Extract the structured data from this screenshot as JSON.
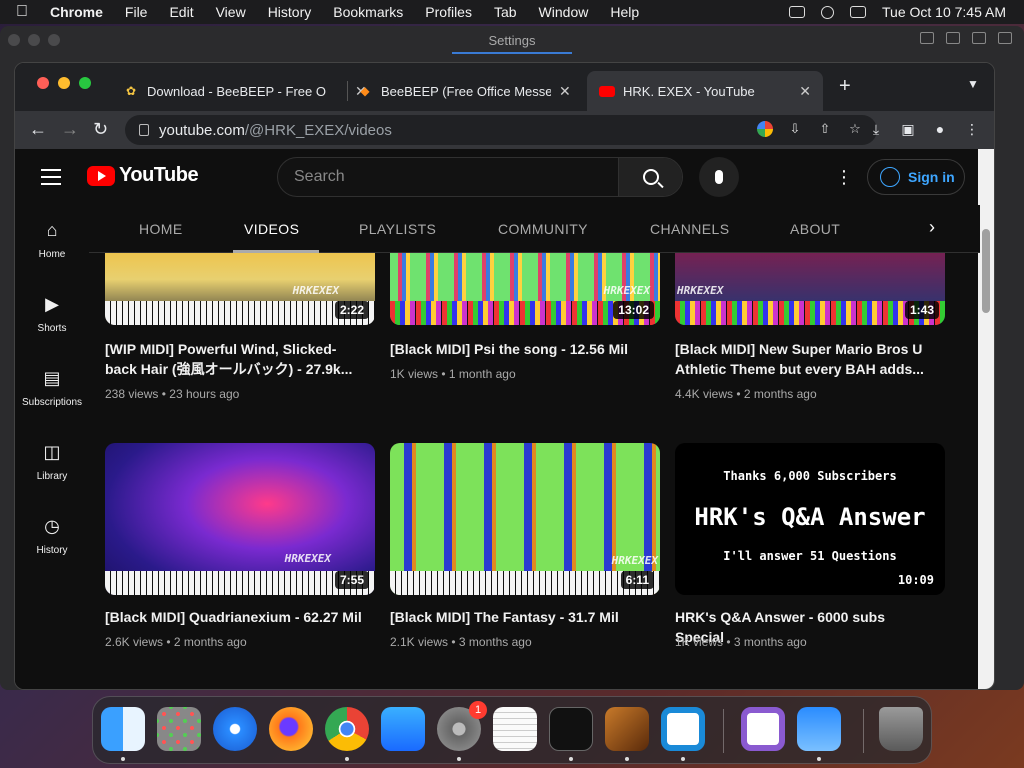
{
  "menubar": {
    "app": "Chrome",
    "items": [
      "File",
      "Edit",
      "View",
      "History",
      "Bookmarks",
      "Profiles",
      "Tab",
      "Window",
      "Help"
    ],
    "clock": "Tue Oct 10  7:45 AM"
  },
  "background_window": {
    "title": "Settings"
  },
  "browser": {
    "tabs": [
      {
        "title": "Download - BeeBEEP - Free O",
        "favicon": "bee-icon"
      },
      {
        "title": "BeeBEEP (Free Office Messen",
        "favicon": "beebeep-icon"
      },
      {
        "title": "HRK. EXEX - YouTube",
        "favicon": "youtube-icon"
      }
    ],
    "url_host": "youtube.com",
    "url_path": "/@HRK_EXEX/videos"
  },
  "youtube": {
    "logo_text": "YouTube",
    "search_placeholder": "Search",
    "signin_label": "Sign in",
    "nav": [
      {
        "label": "Home",
        "icon": "home-icon"
      },
      {
        "label": "Shorts",
        "icon": "shorts-icon"
      },
      {
        "label": "Subscriptions",
        "icon": "subscriptions-icon"
      },
      {
        "label": "Library",
        "icon": "library-icon"
      },
      {
        "label": "History",
        "icon": "history-icon"
      }
    ],
    "channel_tabs": [
      "HOME",
      "VIDEOS",
      "PLAYLISTS",
      "COMMUNITY",
      "CHANNELS",
      "ABOUT"
    ],
    "active_tab": "VIDEOS",
    "videos": [
      {
        "title": "[WIP MIDI] Powerful Wind, Slicked-back Hair (強風オールバック) - 27.9k...",
        "views": "238 views",
        "age": "23 hours ago",
        "duration": "2:22"
      },
      {
        "title": "[Black MIDI] Psi the song - 12.56 Mil",
        "views": "1K views",
        "age": "1 month ago",
        "duration": "13:02"
      },
      {
        "title": "[Black MIDI] New Super Mario Bros U Athletic Theme but every BAH adds...",
        "views": "4.4K views",
        "age": "2 months ago",
        "duration": "1:43"
      },
      {
        "title": "[Black MIDI] Quadrianexium - 62.27 Mil",
        "views": "2.6K views",
        "age": "2 months ago",
        "duration": "7:55"
      },
      {
        "title": "[Black MIDI] The Fantasy - 31.7 Mil",
        "views": "2.1K views",
        "age": "3 months ago",
        "duration": "6:11"
      },
      {
        "title": "HRK's Q&A Answer - 6000 subs Special",
        "views": "1K views",
        "age": "3 months ago",
        "duration": "10:09"
      }
    ],
    "qa_thumb": {
      "line1": "Thanks 6,000 Subscribers",
      "line2": "HRK's Q&A Answer",
      "line3": "I'll answer 51 Questions"
    },
    "watermark": "HRKEXEX",
    "meta_sep": "•"
  },
  "dock": {
    "apps": [
      "finder-icon",
      "launchpad-icon",
      "safari-icon",
      "firefox-icon",
      "chrome-icon",
      "app-store-icon",
      "system-settings-icon",
      "textedit-icon",
      "terminal-icon",
      "garageband-icon",
      "vscode-icon",
      "visual-studio-icon",
      "weather-icon",
      "trash-icon"
    ],
    "settings_badge": "1"
  }
}
